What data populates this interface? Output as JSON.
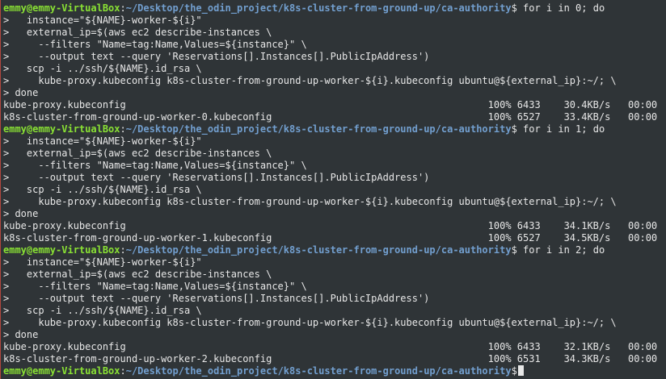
{
  "theme": {
    "background": "#2f3437",
    "prompt_user_color": "#8ae234",
    "prompt_path_color": "#729fcf",
    "text_color": "#e7e7e7"
  },
  "prompt": {
    "user": "emmy@emmy-VirtualBox",
    "sep": ":",
    "path": "~/Desktop/the_odin_project/k8s-cluster-from-ground-up/ca-authority",
    "symbol": "$"
  },
  "lines": [
    ">   instance=\"${NAME}-worker-${i}\"",
    ">   external_ip=$(aws ec2 describe-instances \\",
    ">     --filters \"Name=tag:Name,Values=${instance}\" \\",
    ">     --output text --query 'Reservations[].Instances[].PublicIpAddress')",
    ">   scp -i ../ssh/${NAME}.id_rsa \\",
    ">     kube-proxy.kubeconfig k8s-cluster-from-ground-up-worker-${i}.kubeconfig ubuntu@${external_ip}:~/; \\",
    "> done",
    "kube-proxy.kubeconfig                                                              100% 6433    30.4KB/s   00:00",
    "k8s-cluster-from-ground-up-worker-0.kubeconfig                                     100% 6527    33.4KB/s   00:00",
    "",
    ">   instance=\"${NAME}-worker-${i}\"",
    ">   external_ip=$(aws ec2 describe-instances \\",
    ">     --filters \"Name=tag:Name,Values=${instance}\" \\",
    ">     --output text --query 'Reservations[].Instances[].PublicIpAddress')",
    ">   scp -i ../ssh/${NAME}.id_rsa \\",
    ">     kube-proxy.kubeconfig k8s-cluster-from-ground-up-worker-${i}.kubeconfig ubuntu@${external_ip}:~/; \\",
    "> done",
    "kube-proxy.kubeconfig                                                              100% 6433    34.1KB/s   00:00",
    "k8s-cluster-from-ground-up-worker-1.kubeconfig                                     100% 6527    34.5KB/s   00:00",
    "",
    ">   instance=\"${NAME}-worker-${i}\"",
    ">   external_ip=$(aws ec2 describe-instances \\",
    ">     --filters \"Name=tag:Name,Values=${instance}\" \\",
    ">     --output text --query 'Reservations[].Instances[].PublicIpAddress')",
    ">   scp -i ../ssh/${NAME}.id_rsa \\",
    ">     kube-proxy.kubeconfig k8s-cluster-from-ground-up-worker-${i}.kubeconfig ubuntu@${external_ip}:~/; \\",
    "> done",
    "kube-proxy.kubeconfig                                                              100% 6433    32.1KB/s   00:00",
    "k8s-cluster-from-ground-up-worker-2.kubeconfig                                     100% 6531    34.3KB/s   00:00"
  ],
  "commands": [
    " for i in 0; do",
    " for i in 1; do",
    " for i in 2; do",
    ""
  ]
}
